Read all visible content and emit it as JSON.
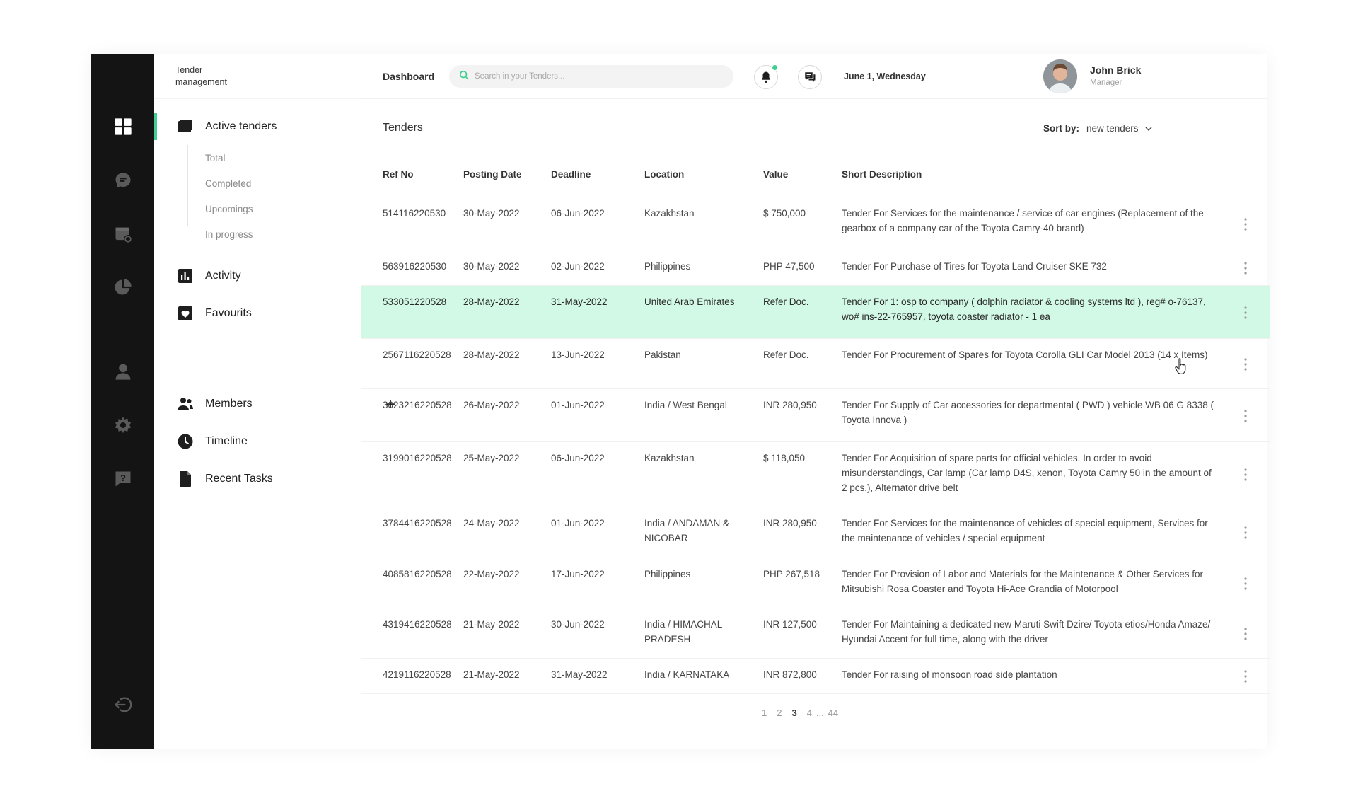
{
  "brand": {
    "line1": "Tender",
    "line2": "management"
  },
  "rail": {
    "icons": [
      "dashboard-icon",
      "chat-icon",
      "calendar-add-icon",
      "pie-chart-icon",
      "user-icon",
      "gear-icon",
      "help-chat-icon",
      "logout-icon"
    ],
    "active": "dashboard-icon",
    "bg_color": "#141414"
  },
  "nav": {
    "active_tenders": "Active tenders",
    "sub_items": [
      "Total",
      "Completed",
      "Upcomings",
      "In progress"
    ],
    "activity": "Activity",
    "favourites": "Favourits",
    "members": "Members",
    "timeline": "Timeline",
    "recent_tasks": "Recent Tasks",
    "accent_color": "#3fcf8e"
  },
  "topbar": {
    "breadcrumb": "Dashboard",
    "search_placeholder": "Search in your Tenders...",
    "date": "June 1, Wednesday",
    "user_name": "John Brick",
    "user_role": "Manager"
  },
  "tenders": {
    "title": "Tenders",
    "sort_label": "Sort by:",
    "sort_value": "new tenders",
    "columns": [
      "Ref No",
      "Posting Date",
      "Deadline",
      "Location",
      "Value",
      "Short Description"
    ],
    "highlight_color": "#d2f8e6",
    "rows": [
      {
        "ref": "514116220530",
        "posting": "30-May-2022",
        "deadline": "06-Jun-2022",
        "location": "Kazakhstan",
        "value": "$ 750,000",
        "desc": "Tender For Services for the maintenance / service of car engines (Replacement of the gearbox of a company car of the Toyota Camry-40 brand)"
      },
      {
        "ref": "563916220530",
        "posting": "30-May-2022",
        "deadline": "02-Jun-2022",
        "location": "Philippines",
        "value": "PHP 47,500",
        "desc": "Tender For Purchase of Tires for Toyota Land Cruiser SKE 732"
      },
      {
        "ref": "533051220528",
        "posting": "28-May-2022",
        "deadline": "31-May-2022",
        "location": "United Arab Emirates",
        "value": "Refer Doc.",
        "desc": "Tender For 1: osp to company ( dolphin radiator & cooling systems ltd ), reg# o-76137, wo# ins-22-765957, toyota coaster radiator - 1 ea",
        "highlighted": true
      },
      {
        "ref": "2567116220528",
        "posting": "28-May-2022",
        "deadline": "13-Jun-2022",
        "location": "Pakistan",
        "value": "Refer Doc.",
        "desc": "Tender For Procurement of Spares for Toyota Corolla GLI Car Model 2013 (14 x Items)"
      },
      {
        "ref": "3023216220528",
        "posting": "26-May-2022",
        "deadline": "01-Jun-2022",
        "location": "India / West Bengal",
        "value": "INR 280,950",
        "desc": "Tender For Supply of Car accessories for departmental ( PWD ) vehicle WB 06 G 8338 ( Toyota Innova )"
      },
      {
        "ref": "3199016220528",
        "posting": "25-May-2022",
        "deadline": "06-Jun-2022",
        "location": "Kazakhstan",
        "value": "$ 118,050",
        "desc": "Tender For Acquisition of spare parts for official vehicles. In order to avoid misunderstandings, Car lamp (Car lamp D4S, xenon, Toyota Camry 50 in the amount of 2 pcs.), Alternator drive belt"
      },
      {
        "ref": "3784416220528",
        "posting": "24-May-2022",
        "deadline": "01-Jun-2022",
        "location": "India / ANDAMAN & NICOBAR",
        "value": "INR 280,950",
        "desc": "Tender For Services for the maintenance of vehicles of special equipment, Services for the maintenance of vehicles / special equipment"
      },
      {
        "ref": "4085816220528",
        "posting": "22-May-2022",
        "deadline": "17-Jun-2022",
        "location": "Philippines",
        "value": "PHP 267,518",
        "desc": "Tender For Provision of Labor and Materials for the Maintenance & Other Services for Mitsubishi Rosa Coaster and Toyota Hi-Ace Grandia of Motorpool"
      },
      {
        "ref": "4319416220528",
        "posting": "21-May-2022",
        "deadline": "30-Jun-2022",
        "location": "India / HIMACHAL PRADESH",
        "value": "INR 127,500",
        "desc": "Tender For Maintaining a dedicated new Maruti Swift Dzire/ Toyota etios/Honda Amaze/ Hyundai Accent for full time, along with the driver"
      },
      {
        "ref": "4219116220528",
        "posting": "21-May-2022",
        "deadline": "31-May-2022",
        "location": "India / KARNATAKA",
        "value": "INR 872,800",
        "desc": "Tender For raising of monsoon road side plantation"
      }
    ]
  },
  "pagination": {
    "pages": [
      "1",
      "2",
      "3",
      "4"
    ],
    "ellipsis": "...",
    "last": "44",
    "current": "3"
  }
}
